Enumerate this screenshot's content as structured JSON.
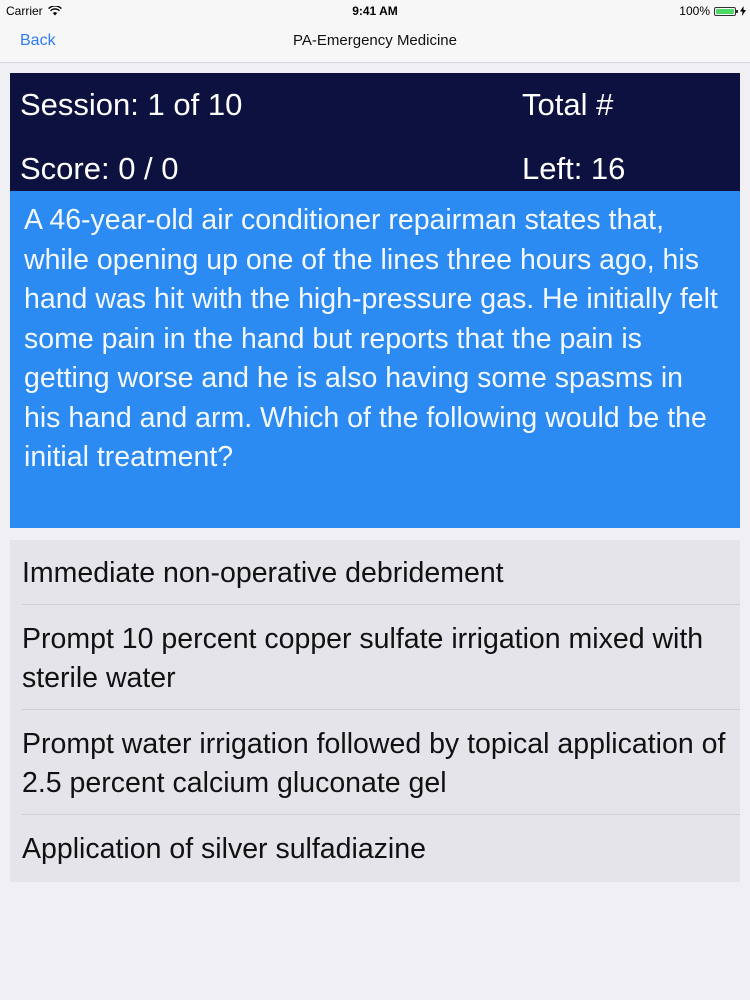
{
  "status_bar": {
    "carrier": "Carrier",
    "time": "9:41 AM",
    "battery": "100%",
    "battery_level": 1.0,
    "wifi_icon": "wifi-icon",
    "charging_icon": "bolt-icon"
  },
  "nav": {
    "back_label": "Back",
    "title": "PA-Emergency Medicine"
  },
  "header": {
    "session": "Session: 1 of 10",
    "total": "Total #",
    "score": "Score: 0 / 0",
    "left": "Left: 16"
  },
  "question": "A 46-year-old air conditioner repairman states that, while opening up one of the lines three hours ago, his hand was hit with the high-pressure gas. He initially felt some pain in the hand but reports that the pain is getting worse and he is also having some spasms in his hand and arm.  Which of the following would be the initial treatment?",
  "answers": [
    "Immediate non-operative debridement",
    "Prompt 10 percent copper sulfate irrigation mixed with sterile water",
    "Prompt water irrigation followed by topical application of 2.5 percent calcium gluconate gel",
    "Application of silver sulfadiazine"
  ],
  "colors": {
    "header_bg": "#0d1140",
    "question_bg": "#2b8bf2",
    "answers_bg": "#e4e4ea",
    "link": "#2f7cf6"
  }
}
